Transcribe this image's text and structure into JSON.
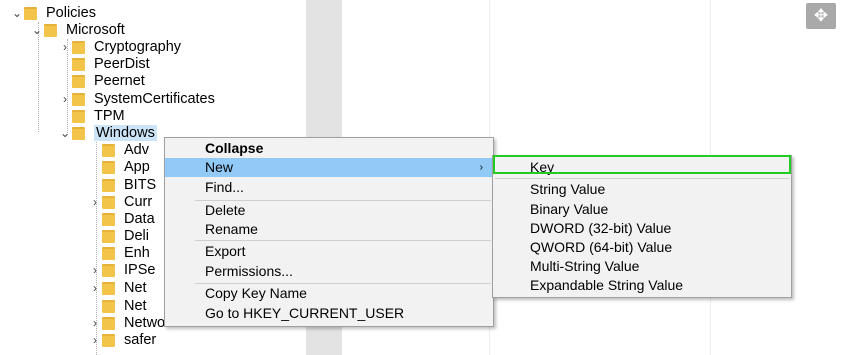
{
  "tree": {
    "items": [
      {
        "label": "Policies",
        "chevron": "⌄"
      },
      {
        "label": "Microsoft",
        "chevron": "⌄"
      },
      {
        "label": "Cryptography",
        "chevron": "›"
      },
      {
        "label": "PeerDist",
        "chevron": ""
      },
      {
        "label": "Peernet",
        "chevron": ""
      },
      {
        "label": "SystemCertificates",
        "chevron": "›"
      },
      {
        "label": "TPM",
        "chevron": ""
      },
      {
        "label": "Windows",
        "chevron": "⌄"
      },
      {
        "label": "Adv",
        "chevron": ""
      },
      {
        "label": "App",
        "chevron": ""
      },
      {
        "label": "BITS",
        "chevron": ""
      },
      {
        "label": "Curr",
        "chevron": "›"
      },
      {
        "label": "Data",
        "chevron": ""
      },
      {
        "label": "Deli",
        "chevron": ""
      },
      {
        "label": "Enh",
        "chevron": ""
      },
      {
        "label": "IPSe",
        "chevron": "›"
      },
      {
        "label": "Net",
        "chevron": "›"
      },
      {
        "label": "Net",
        "chevron": ""
      },
      {
        "label": "NetworkProvider",
        "chevron": "›"
      },
      {
        "label": "safer",
        "chevron": "›"
      }
    ]
  },
  "context_menu": {
    "items": [
      "Collapse",
      "New",
      "Find...",
      "Delete",
      "Rename",
      "Export",
      "Permissions...",
      "Copy Key Name",
      "Go to HKEY_CURRENT_USER"
    ],
    "new_arrow": "›"
  },
  "submenu": {
    "items": [
      "Key",
      "String Value",
      "Binary Value",
      "DWORD (32-bit) Value",
      "QWORD (64-bit) Value",
      "Multi-String Value",
      "Expandable String Value"
    ]
  },
  "icons": {
    "move": "move-icon",
    "folder": "folder-icon"
  },
  "colors": {
    "highlight": "#91c9f7",
    "selection_box": "#22cc22",
    "folder": "#f3c44a"
  }
}
